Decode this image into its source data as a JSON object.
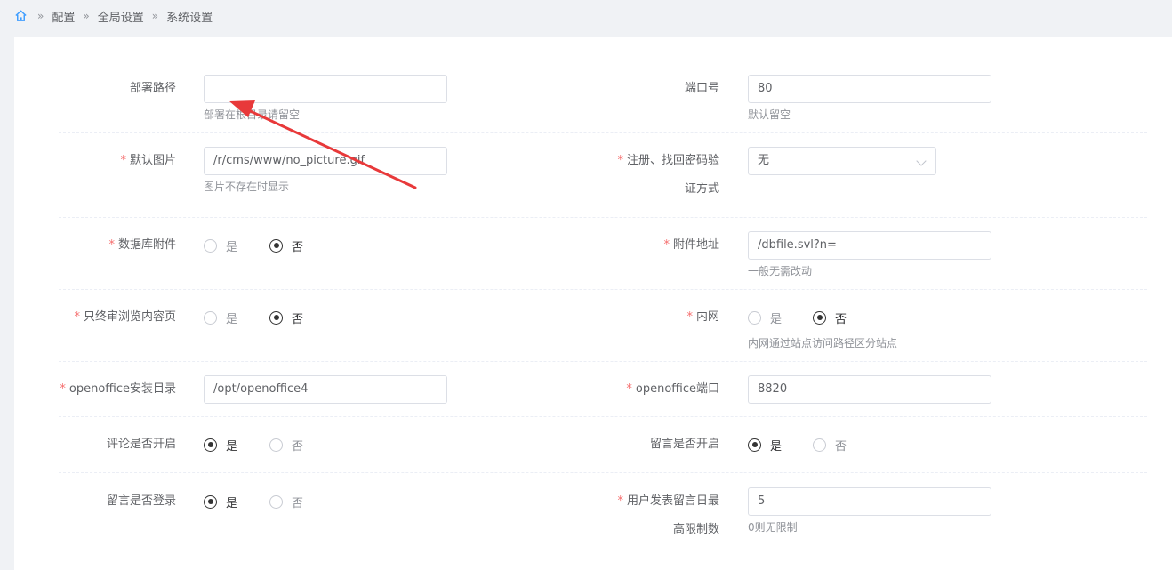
{
  "breadcrumb": [
    "配置",
    "全局设置",
    "系统设置"
  ],
  "form": {
    "deploy_path": {
      "label": "部署路径",
      "value": "",
      "help": "部署在根目录请留空"
    },
    "port": {
      "label": "端口号",
      "value": "80",
      "help": "默认留空"
    },
    "default_image": {
      "label": "默认图片",
      "value": "/r/cms/www/no_picture.gif",
      "help": "图片不存在时显示"
    },
    "verify_method": {
      "label_line1": "注册、找回密码验",
      "label_line2": "证方式",
      "value": "无"
    },
    "db_attachment": {
      "label": "数据库附件",
      "yes": "是",
      "no": "否",
      "selected": "否"
    },
    "attachment_url": {
      "label": "附件地址",
      "value": "/dbfile.svl?n=",
      "help": "一般无需改动"
    },
    "final_review_browse": {
      "label": "只终审浏览内容页",
      "yes": "是",
      "no": "否",
      "selected": "否"
    },
    "intranet": {
      "label": "内网",
      "yes": "是",
      "no": "否",
      "selected": "否",
      "help": "内网通过站点访问路径区分站点"
    },
    "openoffice_dir": {
      "label": "openoffice安装目录",
      "value": "/opt/openoffice4"
    },
    "openoffice_port": {
      "label": "openoffice端口",
      "value": "8820"
    },
    "comment_enabled": {
      "label": "评论是否开启",
      "yes": "是",
      "no": "否",
      "selected": "是"
    },
    "message_enabled": {
      "label": "留言是否开启",
      "yes": "是",
      "no": "否",
      "selected": "是"
    },
    "message_login": {
      "label": "留言是否登录",
      "yes": "是",
      "no": "否",
      "selected": "是"
    },
    "message_daily_limit": {
      "label_line1": "用户发表留言日最",
      "label_line2": "高限制数",
      "value": "5",
      "help": "0则无限制"
    }
  },
  "colors": {
    "required": "#f56c6c",
    "annotation_arrow": "#e8393a"
  }
}
